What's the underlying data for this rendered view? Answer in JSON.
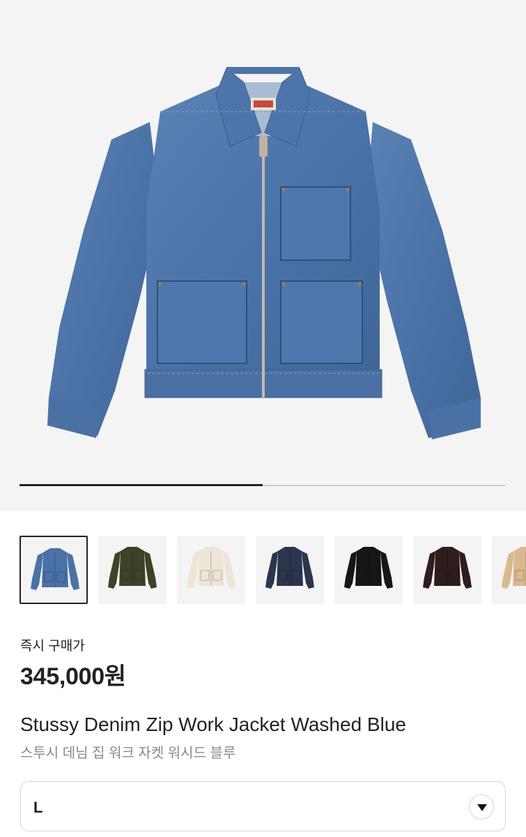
{
  "product_image": {
    "name": "denim-jacket-photo",
    "slide_progress": 0.5
  },
  "thumbnails": [
    {
      "color": "#4a72a6",
      "selected": true
    },
    {
      "color": "#3d4326",
      "selected": false
    },
    {
      "color": "#ede6d8",
      "selected": false
    },
    {
      "color": "#2b354d",
      "selected": false
    },
    {
      "color": "#161616",
      "selected": false
    },
    {
      "color": "#2e1d1c",
      "selected": false
    },
    {
      "color": "#d9b88e",
      "selected": false
    }
  ],
  "purchase": {
    "label": "즉시 구매가",
    "price": "345,000원"
  },
  "product": {
    "name_en": "Stussy Denim Zip Work Jacket Washed Blue",
    "name_ko": "스투시 데님 집 워크 자켓 워시드 블루"
  },
  "size_select": {
    "value": "L",
    "icon": "chevron-down-icon"
  }
}
